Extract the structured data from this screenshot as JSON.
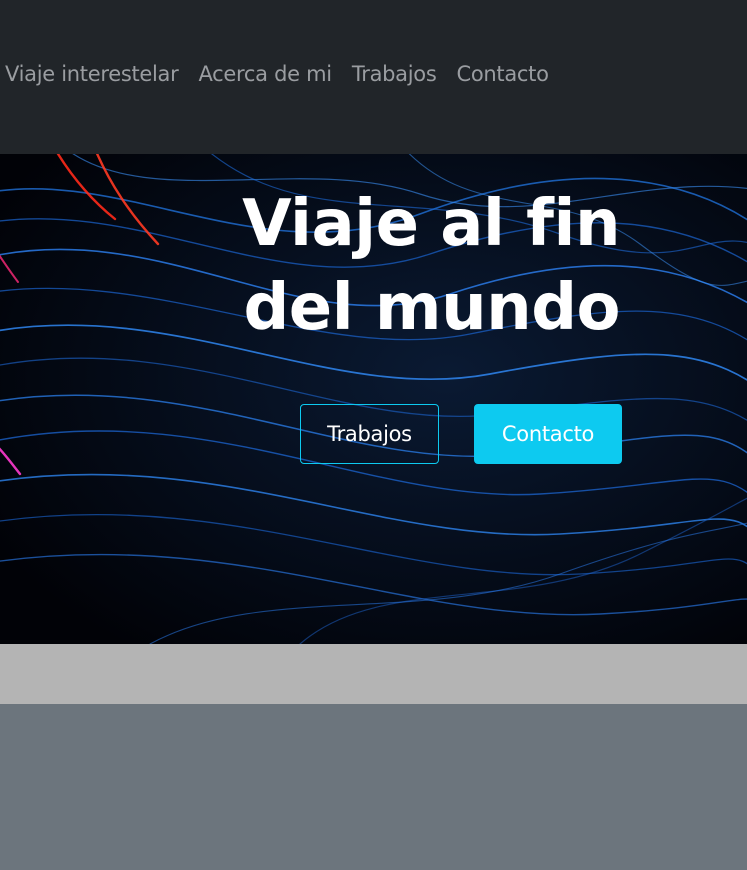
{
  "nav": {
    "items": [
      {
        "label": "Viaje interestelar"
      },
      {
        "label": "Acerca de mi"
      },
      {
        "label": "Trabajos"
      },
      {
        "label": "Contacto"
      }
    ]
  },
  "hero": {
    "title": "Viaje al fin del mundo",
    "buttons": {
      "primary_outline": "Trabajos",
      "info": "Contacto"
    }
  },
  "colors": {
    "navbar_bg": "#212529",
    "nav_link": "#9a9da1",
    "accent": "#0dcaf0",
    "band": "#b4b4b4",
    "footer_bg": "#6c757d"
  }
}
